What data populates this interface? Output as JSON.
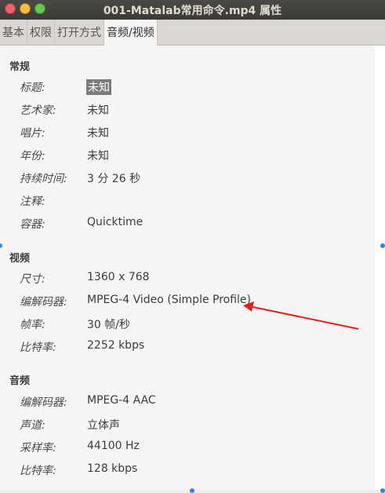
{
  "window": {
    "title": "001-Matalab常用命令.mp4 属性",
    "colors": {
      "close": "#f46067",
      "minimize": "#f9be3e",
      "maximize": "#68c84e",
      "arrow": "#e0201f"
    }
  },
  "tabs": [
    "基本",
    "权限",
    "打开方式",
    "音频/视频"
  ],
  "general": {
    "heading": "常规",
    "rows": [
      {
        "label": "标题:",
        "value": "未知"
      },
      {
        "label": "艺术家:",
        "value": "未知"
      },
      {
        "label": "唱片:",
        "value": "未知"
      },
      {
        "label": "年份:",
        "value": "未知"
      },
      {
        "label": "持续时间:",
        "value": "3 分 26 秒"
      },
      {
        "label": "注释:",
        "value": ""
      },
      {
        "label": "容器:",
        "value": "Quicktime"
      }
    ]
  },
  "video": {
    "heading": "视频",
    "rows": [
      {
        "label": "尺寸:",
        "value": "1360 x 768"
      },
      {
        "label": "编解码器:",
        "value": "MPEG-4 Video (Simple Profile)"
      },
      {
        "label": "帧率:",
        "value": "30 帧/秒"
      },
      {
        "label": "比特率:",
        "value": "2252 kbps"
      }
    ]
  },
  "audio": {
    "heading": "音频",
    "rows": [
      {
        "label": "编解码器:",
        "value": "MPEG-4 AAC"
      },
      {
        "label": "声道:",
        "value": "立体声"
      },
      {
        "label": "采样率:",
        "value": "44100 Hz"
      },
      {
        "label": "比特率:",
        "value": "128 kbps"
      }
    ]
  }
}
